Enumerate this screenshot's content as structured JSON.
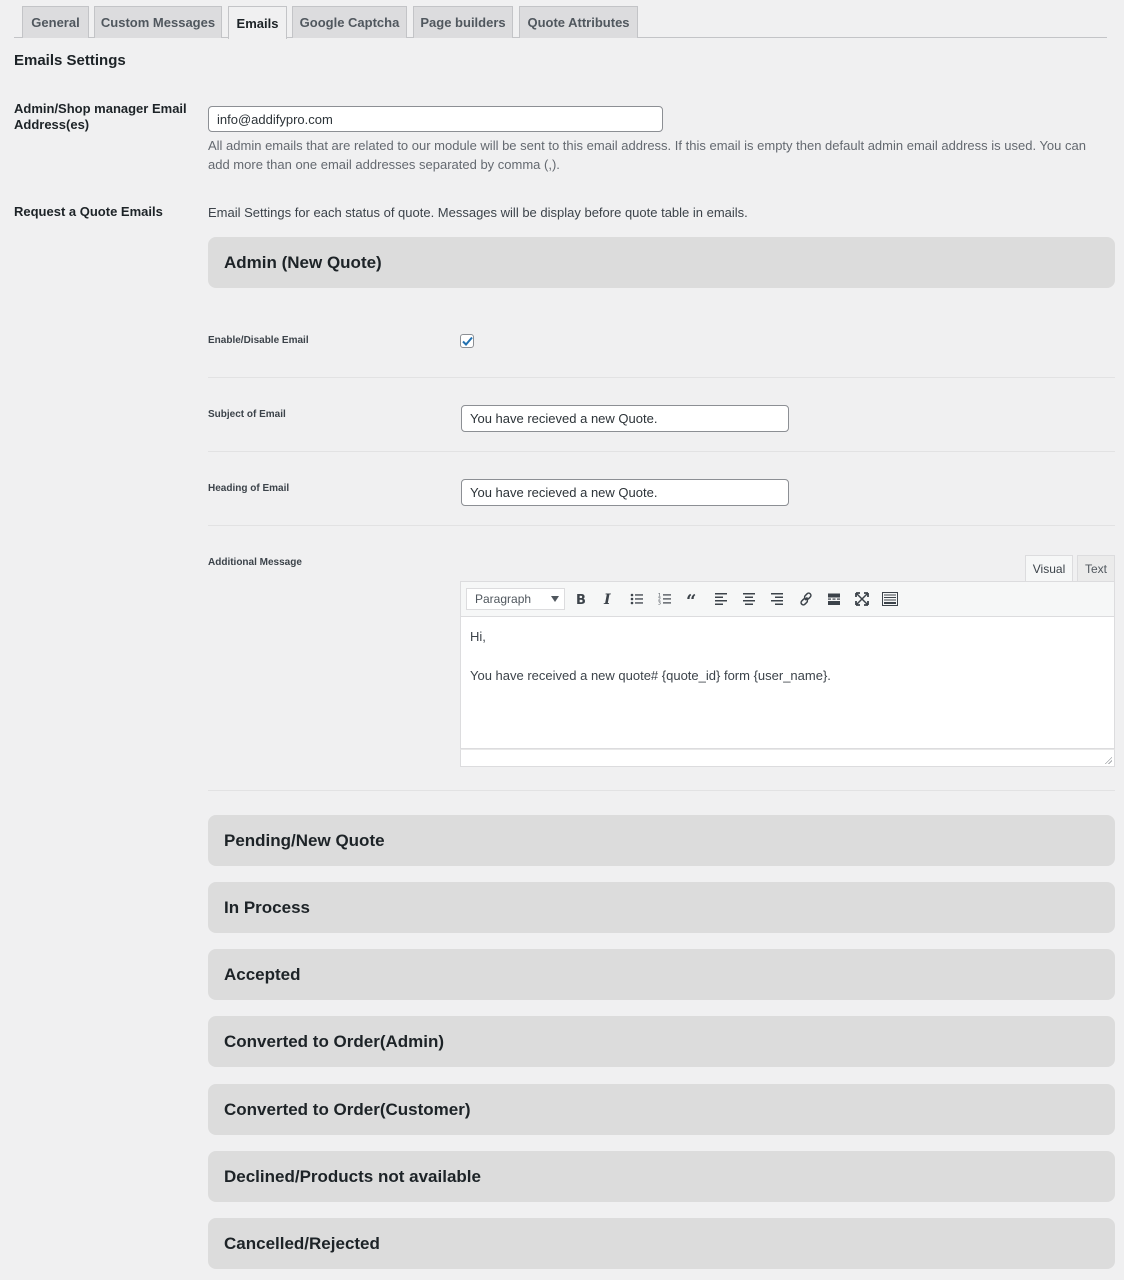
{
  "tabs": [
    {
      "label": "General",
      "active": false
    },
    {
      "label": "Custom Messages",
      "active": false
    },
    {
      "label": "Emails",
      "active": true
    },
    {
      "label": "Google Captcha",
      "active": false
    },
    {
      "label": "Page builders",
      "active": false
    },
    {
      "label": "Quote Attributes",
      "active": false
    }
  ],
  "section_title": "Emails Settings",
  "admin_email": {
    "label": "Admin/Shop manager Email Address(es)",
    "value": "info@addifypro.com",
    "description": "All admin emails that are related to our module will be sent to this email address. If this email is empty then default admin email address is used. You can add more than one email addresses separated by comma (,)."
  },
  "quote_emails": {
    "label": "Request a Quote Emails",
    "description": "Email Settings for each status of quote. Messages will be display before quote table in emails."
  },
  "admin_new_quote": {
    "title": "Admin (New Quote)",
    "enable_label": "Enable/Disable Email",
    "enabled": true,
    "subject_label": "Subject of Email",
    "subject_value": "You have recieved a new Quote.",
    "heading_label": "Heading of Email",
    "heading_value": "You have recieved a new Quote.",
    "message_label": "Additional Message",
    "editor": {
      "tab_visual": "Visual",
      "tab_text": "Text",
      "format_value": "Paragraph",
      "toolbar": [
        "bold",
        "italic",
        "bullet-list",
        "numbered-list",
        "blockquote",
        "align-left",
        "align-center",
        "align-right",
        "link",
        "read-more",
        "fullscreen",
        "toolbar-toggle"
      ],
      "content": [
        "Hi,",
        "You have received a new quote# {quote_id} form {user_name}."
      ]
    }
  },
  "status_sections": [
    "Pending/New Quote",
    "In Process",
    "Accepted",
    "Converted to Order(Admin)",
    "Converted to Order(Customer)",
    "Declined/Products not available",
    "Cancelled/Rejected"
  ],
  "colors": {
    "checkbox_check": "#2271b1",
    "accordion_bg": "#dcdcdc",
    "page_bg": "#f0f0f1"
  }
}
